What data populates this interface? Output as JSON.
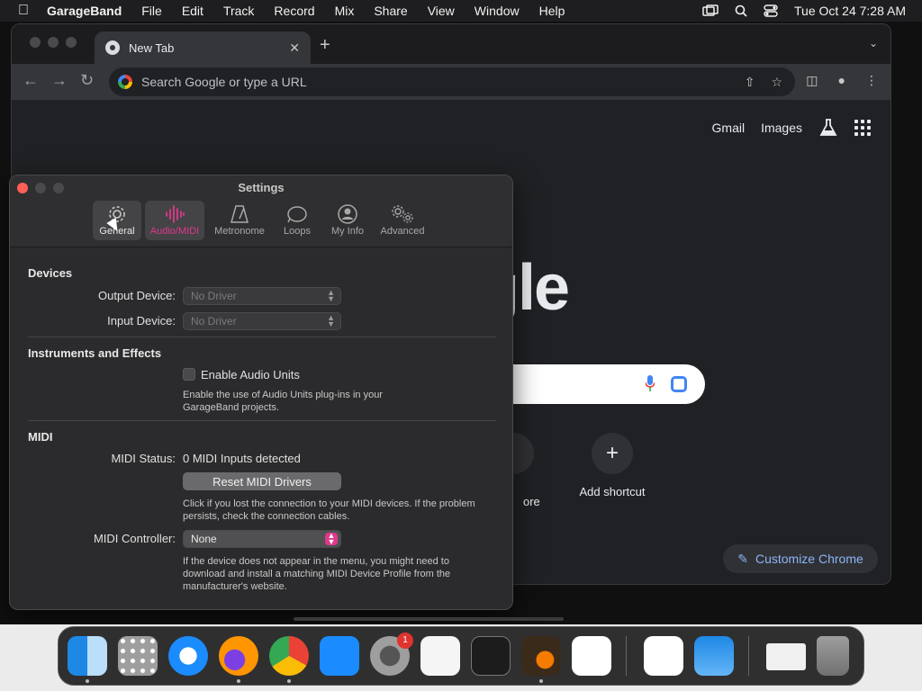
{
  "menubar": {
    "app_name": "GarageBand",
    "items": [
      "File",
      "Edit",
      "Track",
      "Record",
      "Mix",
      "Share",
      "View",
      "Window",
      "Help"
    ],
    "clock": "Tue Oct 24  7:28 AM"
  },
  "chrome": {
    "tab_title": "New Tab",
    "omnibox_placeholder": "Search Google or type a URL",
    "top_links": [
      "Gmail",
      "Images"
    ],
    "logo_fragment": "gle",
    "shortcut_add_label": "Add shortcut",
    "shortcut_partial_label": "ore",
    "customize_label": "Customize Chrome"
  },
  "settings": {
    "title": "Settings",
    "tabs": [
      {
        "label": "General",
        "icon": "gear-icon"
      },
      {
        "label": "Audio/MIDI",
        "icon": "waveform-icon"
      },
      {
        "label": "Metronome",
        "icon": "metronome-icon"
      },
      {
        "label": "Loops",
        "icon": "loop-icon"
      },
      {
        "label": "My Info",
        "icon": "person-icon"
      },
      {
        "label": "Advanced",
        "icon": "gears-icon"
      }
    ],
    "devices": {
      "heading": "Devices",
      "output_label": "Output Device:",
      "output_value": "No Driver",
      "input_label": "Input Device:",
      "input_value": "No Driver"
    },
    "instruments": {
      "heading": "Instruments and Effects",
      "checkbox_label": "Enable Audio Units",
      "help": "Enable the use of Audio Units plug-ins in your GarageBand projects."
    },
    "midi": {
      "heading": "MIDI",
      "status_label": "MIDI Status:",
      "status_value": "0 MIDI Inputs detected",
      "reset_button": "Reset MIDI Drivers",
      "reset_help": "Click if you lost the connection to your MIDI devices. If the problem persists, check the connection cables.",
      "controller_label": "MIDI Controller:",
      "controller_value": "None",
      "controller_help": "If the device does not appear in the menu, you might need to download and install a matching MIDI Device Profile from the manufacturer's website."
    }
  },
  "dock": {
    "apps": [
      "Finder",
      "Launchpad",
      "Safari",
      "Firefox",
      "Chrome",
      "App Store",
      "System Settings",
      "TextEdit",
      "Terminal",
      "GarageBand",
      "VS Code",
      "Visual Studio",
      "Weather",
      "Preview",
      "Trash"
    ],
    "settings_badge": "1"
  }
}
